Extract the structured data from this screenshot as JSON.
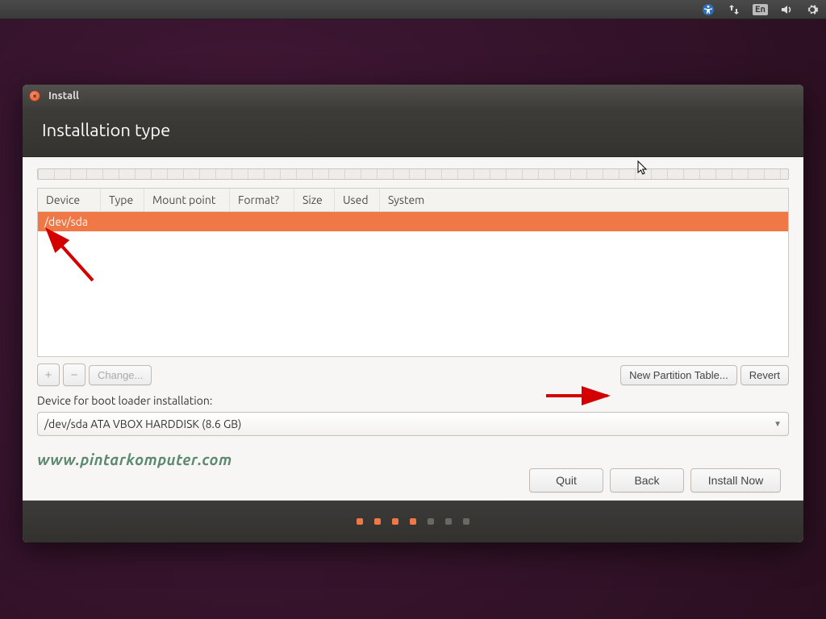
{
  "menubar": {
    "lang": "En"
  },
  "window": {
    "title": "Install",
    "header": "Installation type"
  },
  "table": {
    "columns": [
      "Device",
      "Type",
      "Mount point",
      "Format?",
      "Size",
      "Used",
      "System"
    ],
    "selected_device": "/dev/sda"
  },
  "toolbar": {
    "add": "+",
    "remove": "−",
    "change": "Change...",
    "new_partition": "New Partition Table...",
    "revert": "Revert"
  },
  "boot": {
    "label": "Device for boot loader installation:",
    "value": "/dev/sda  ATA VBOX HARDDISK (8.6 GB)"
  },
  "watermark": "www.pintarkomputer.com",
  "actions": {
    "quit": "Quit",
    "back": "Back",
    "install": "Install Now"
  },
  "progress": {
    "current": 4,
    "total": 7
  }
}
